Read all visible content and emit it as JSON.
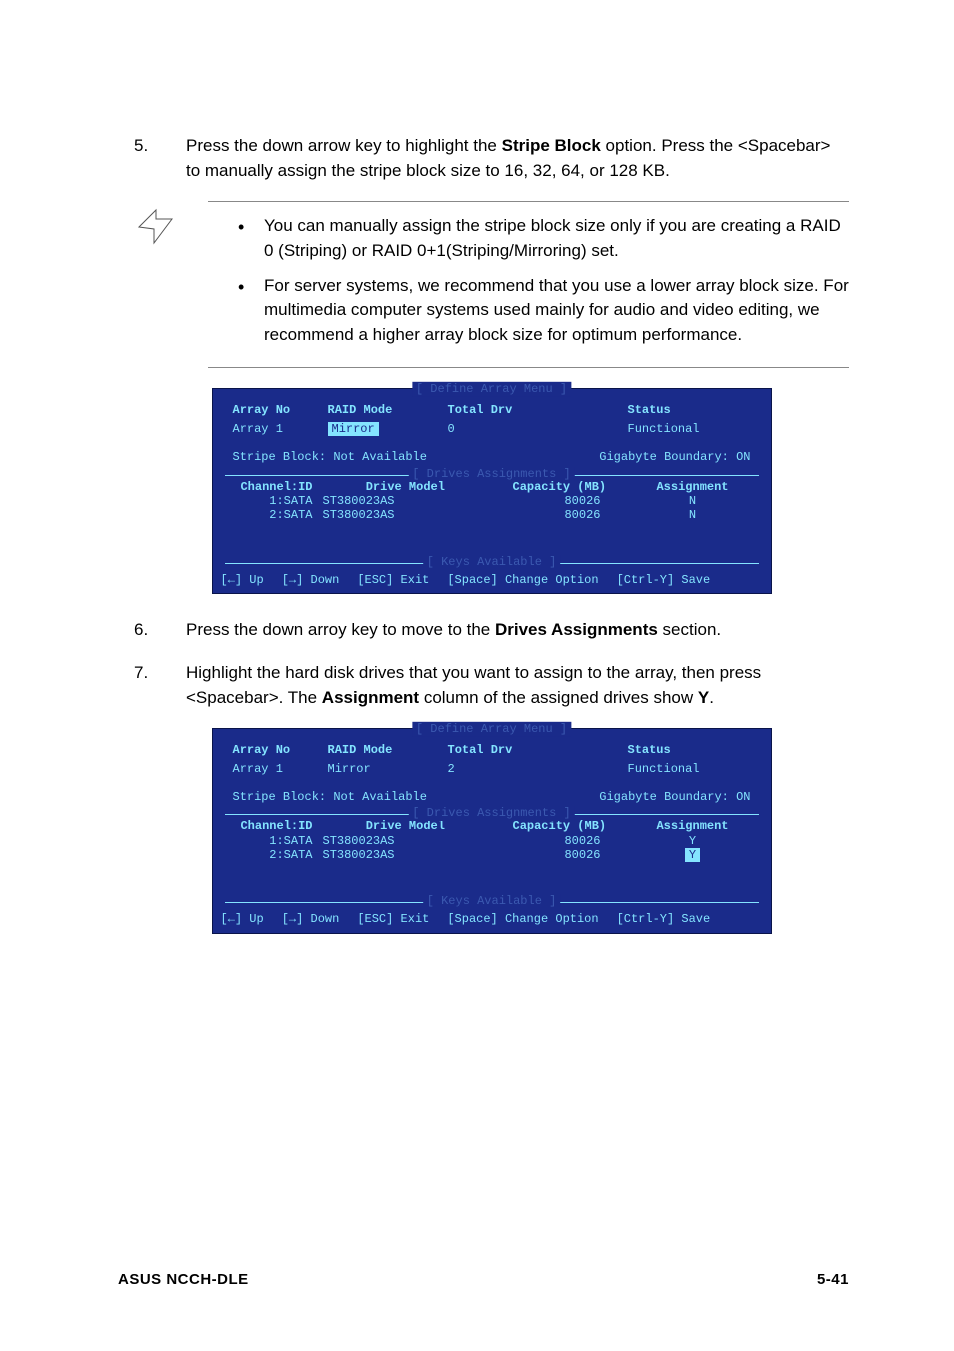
{
  "steps": {
    "s5": {
      "num": "5.",
      "text_a": "Press the down arrow key to highlight the ",
      "bold_a": "Stripe Block",
      "text_b": " option. Press the <Spacebar> to manually assign the stripe block size to 16, 32, 64, or 128 KB."
    },
    "s6": {
      "num": "6.",
      "text_a": "Press the down arroy key to move to the ",
      "bold_a": "Drives Assignments",
      "text_b": " section."
    },
    "s7": {
      "num": "7.",
      "text_a": "Highlight the hard disk drives that you want to assign to the array, then press <Spacebar>. The ",
      "bold_a": "Assignment",
      "text_b": " column of the assigned drives show ",
      "bold_b": "Y",
      "text_c": "."
    }
  },
  "notes": {
    "n1": "You can manually assign the stripe block size only if you are creating a RAID 0 (Striping) or RAID 0+1(Striping/Mirroring) set.",
    "n2": "For server systems, we recommend that you use a lower array block size. For multimedia computer systems used mainly for audio and video editing, we recommend a higher array block size for optimum performance."
  },
  "bios_common": {
    "title": "[ Define Array Menu ]",
    "hdr_arrayno": "Array No",
    "hdr_raidmode": "RAID Mode",
    "hdr_totaldrv": "Total Drv",
    "hdr_status": "Status",
    "array_label": "Array 1",
    "raid_mode": "Mirror",
    "status": "Functional",
    "stripe_label": "Stripe Block:",
    "stripe_value": "Not Available",
    "gb_label": "Gigabyte Boundary: ON",
    "inner_title": "[ Drives Assignments ]",
    "dhdr_chan": "Channel:ID",
    "dhdr_model": "Drive Model",
    "dhdr_cap": "Capacity (MB)",
    "dhdr_ass": "Assignment",
    "r1_chan": "1:SATA",
    "r1_model": "ST380023AS",
    "r1_cap": "80026",
    "r2_chan": "2:SATA",
    "r2_model": "ST380023AS",
    "r2_cap": "80026",
    "keys_title": "[ Keys Available ]",
    "k1": "[←] Up",
    "k2": "[→] Down",
    "k3": "[ESC] Exit",
    "k4": "[Space] Change Option",
    "k5": "[Ctrl-Y] Save"
  },
  "bios1": {
    "total_drv": "0",
    "r1_ass": "N",
    "r2_ass": "N"
  },
  "bios2": {
    "total_drv": "2",
    "r1_ass": "Y",
    "r2_ass": "Y"
  },
  "footer": {
    "left": "ASUS NCCH-DLE",
    "right": "5-41"
  }
}
